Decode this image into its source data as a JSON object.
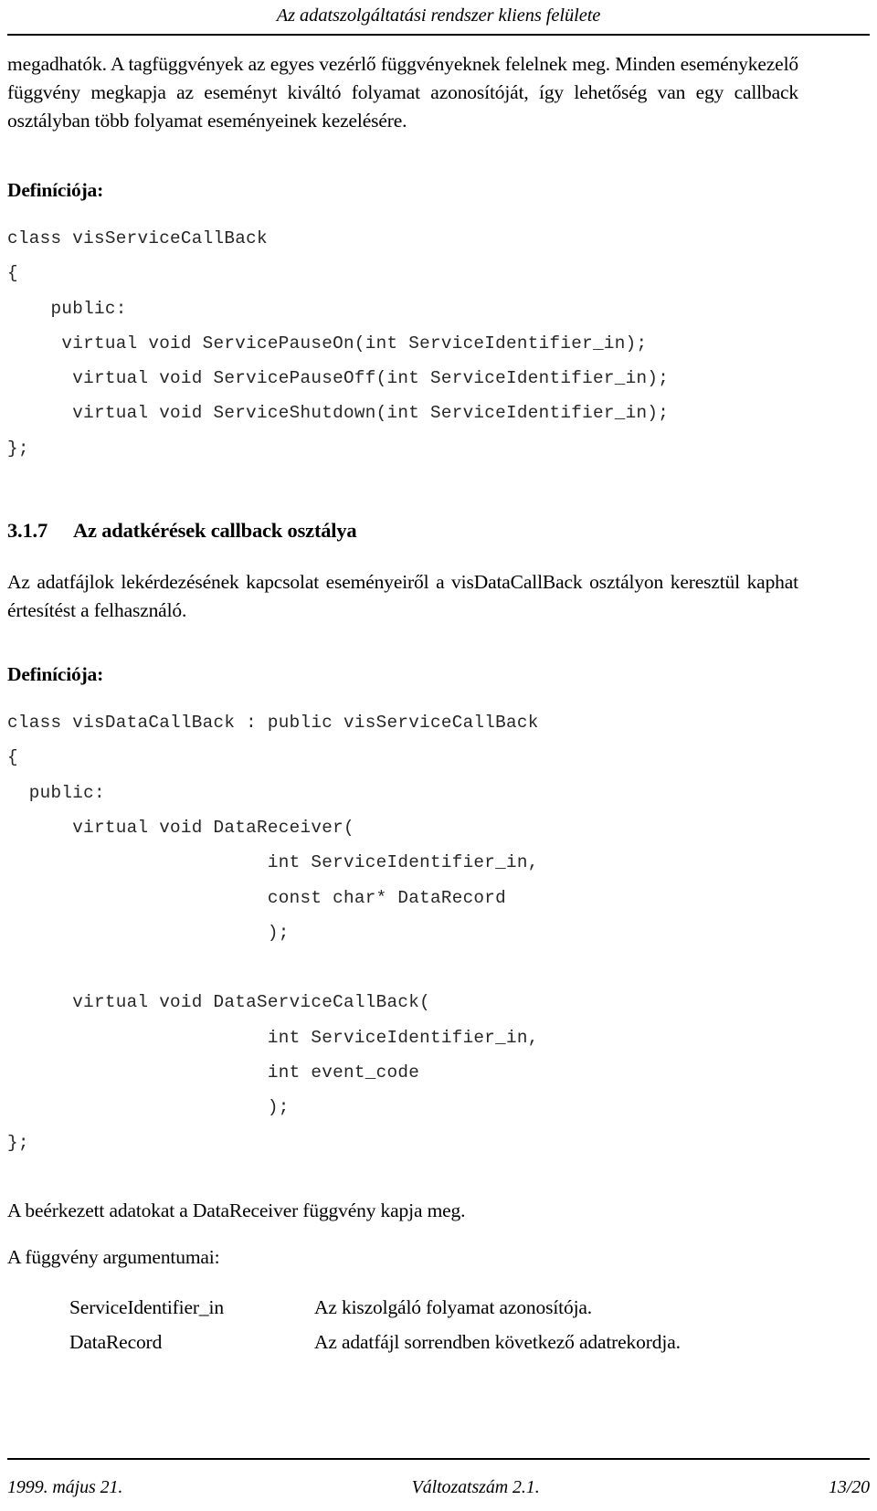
{
  "header": {
    "running_title": "Az adatszolgáltatási rendszer kliens felülete"
  },
  "body": {
    "intro_paragraph": "megadhatók. A tagfüggvények az egyes vezérlő függvényeknek felelnek meg. Minden eseménykezelő függvény megkapja az eseményt kiváltó folyamat azonosítóját, így lehetőség van egy callback osztályban több folyamat eseményeinek kezelésére.",
    "definition_label_1": "Definíciója:",
    "code_block_1": "class visServiceCallBack\n{\n    public:\n     virtual void ServicePauseOn(int ServiceIdentifier_in);\n      virtual void ServicePauseOff(int ServiceIdentifier_in);\n      virtual void ServiceShutdown(int ServiceIdentifier_in);\n};",
    "section": {
      "number": "3.1.7",
      "title": "Az adatkérések callback osztálya"
    },
    "section_paragraph": "Az adatfájlok lekérdezésének kapcsolat eseményeiről a visDataCallBack osztályon keresztül kaphat értesítést a felhasználó.",
    "definition_label_2": "Definíciója:",
    "code_block_2": "class visDataCallBack : public visServiceCallBack\n{\n  public:\n      virtual void DataReceiver(\n                        int ServiceIdentifier_in,\n                        const char* DataRecord\n                        );\n\n      virtual void DataServiceCallBack(\n                        int ServiceIdentifier_in,\n                        int event_code\n                        );\n};",
    "closing_paragraph": "A beérkezett adatokat a DataReceiver függvény kapja meg.",
    "arguments_label": "A függvény argumentumai:",
    "arguments": [
      {
        "name": "ServiceIdentifier_in",
        "description": "Az kiszolgáló folyamat azonosítója."
      },
      {
        "name": "DataRecord",
        "description": "Az adatfájl sorrendben következő adatrekordja."
      }
    ]
  },
  "footer": {
    "date": "1999. május 21.",
    "version": "Változatszám 2.1.",
    "page": "13/20"
  }
}
